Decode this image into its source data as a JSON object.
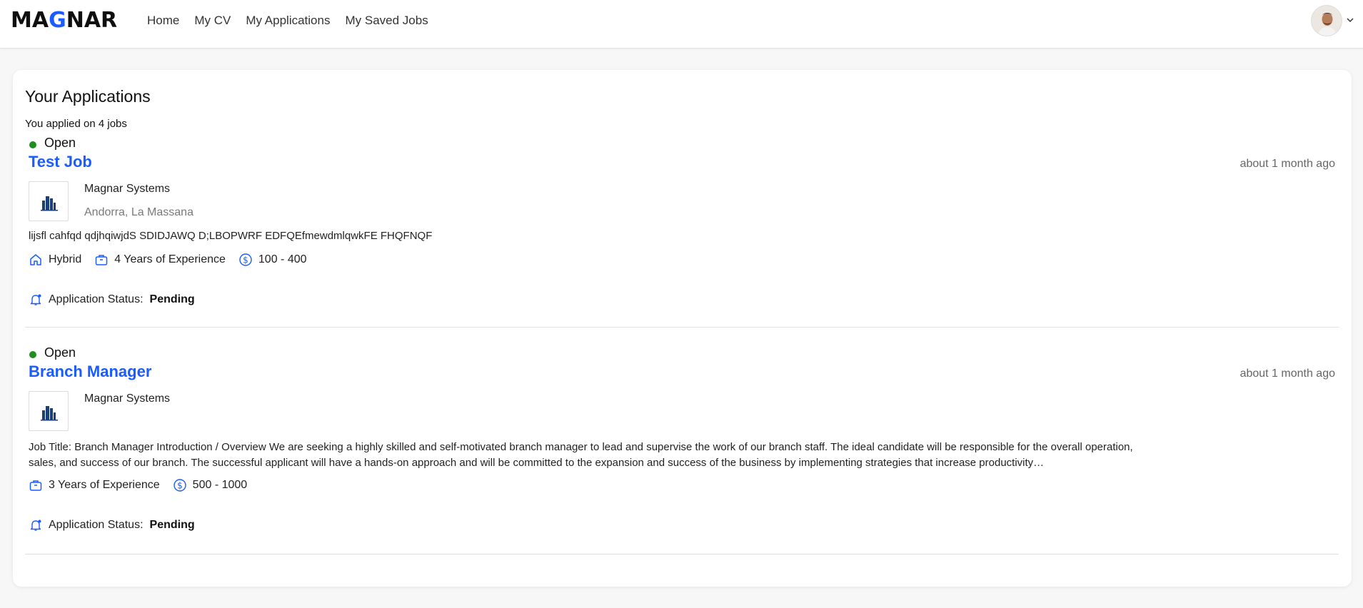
{
  "header": {
    "logo_text": "MAGNAR",
    "nav": [
      "Home",
      "My CV",
      "My Applications",
      "My Saved Jobs"
    ]
  },
  "main": {
    "title": "Your Applications",
    "count_text": "You applied on 4 jobs",
    "applications": [
      {
        "status": "Open",
        "title": "Test Job",
        "posted": "about 1 month ago",
        "company": "Magnar Systems",
        "location": "Andorra, La Massana",
        "description": "lijsfl cahfqd qdjhqiwjdS SDIDJAWQ D;LBOPWRF EDFQEfmewdmlqwkFE FHQFNQF",
        "work_mode": "Hybrid",
        "experience": "4 Years of Experience",
        "salary": "100 - 400",
        "status_label": "Application Status:",
        "status_value": "Pending"
      },
      {
        "status": "Open",
        "title": "Branch Manager",
        "posted": "about 1 month ago",
        "company": "Magnar Systems",
        "description": "Job Title: Branch Manager Introduction / Overview We are seeking a highly skilled and self-motivated branch manager to lead and supervise the work of our branch staff. The ideal candidate will be responsible for the overall operation, sales, and success of our branch. The successful applicant will have a hands-on approach and will be committed to the expansion and success of the business by implementing strategies that increase productivity…",
        "experience": "3 Years of Experience",
        "salary": "500 - 1000",
        "status_label": "Application Status:",
        "status_value": "Pending"
      }
    ]
  },
  "colors": {
    "accent": "#1a5cff",
    "status_open": "#1e8e1e"
  },
  "icons": {
    "home": "home-icon",
    "briefcase": "briefcase-icon",
    "dollar": "dollar-icon",
    "bell": "bell-icon",
    "caret": "chevron-down-icon"
  }
}
